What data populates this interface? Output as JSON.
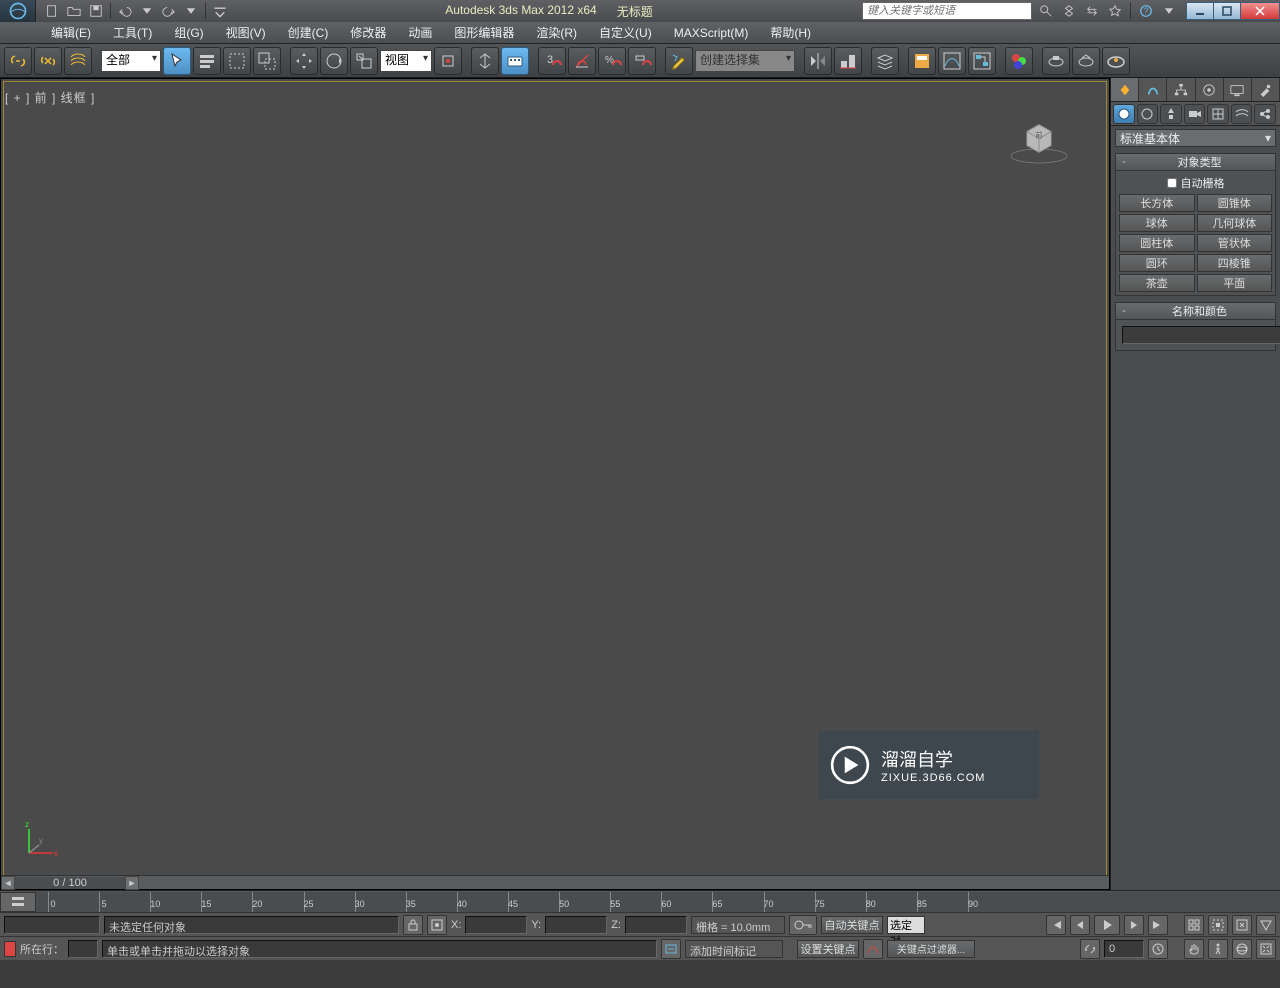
{
  "title": {
    "app": "Autodesk 3ds Max  2012 x64",
    "doc": "无标题"
  },
  "search": {
    "placeholder": "键入关键字或短语"
  },
  "menu": {
    "items": [
      "编辑(E)",
      "工具(T)",
      "组(G)",
      "视图(V)",
      "创建(C)",
      "修改器",
      "动画",
      "图形编辑器",
      "渲染(R)",
      "自定义(U)",
      "MAXScript(M)",
      "帮助(H)"
    ]
  },
  "toolbar": {
    "filter_all": "全部",
    "refcoord": "视图",
    "named_sel": "创建选择集"
  },
  "viewport": {
    "label": "[ + ] 前 ] 线框 ]",
    "frame_display": "0 / 100"
  },
  "cmd": {
    "category": "标准基本体",
    "rollout_type": "对象类型",
    "autogrid": "自动栅格",
    "primitives": [
      "长方体",
      "圆锥体",
      "球体",
      "几何球体",
      "圆柱体",
      "管状体",
      "圆环",
      "四棱锥",
      "茶壶",
      "平面"
    ],
    "rollout_namecolor": "名称和颜色"
  },
  "timeline": {
    "ticks": [
      0,
      5,
      10,
      15,
      20,
      25,
      30,
      35,
      40,
      45,
      50,
      55,
      60,
      65,
      70,
      75,
      80,
      85,
      90
    ]
  },
  "status": {
    "no_sel": "未选定任何对象",
    "prompt": "单击或单击并拖动以选择对象",
    "x": "X:",
    "y": "Y:",
    "z": "Z:",
    "grid": "栅格 = 10.0mm",
    "autokey": "自动关键点",
    "setkey": "设置关键点",
    "keyfilters": "关键点过滤器...",
    "selected": "选定对",
    "add_time_tag": "添加时间标记",
    "cur_line": "所在行：",
    "frame_now": "0"
  },
  "watermark": {
    "main": "溜溜自学",
    "sub": "ZIXUE.3D66.COM"
  }
}
